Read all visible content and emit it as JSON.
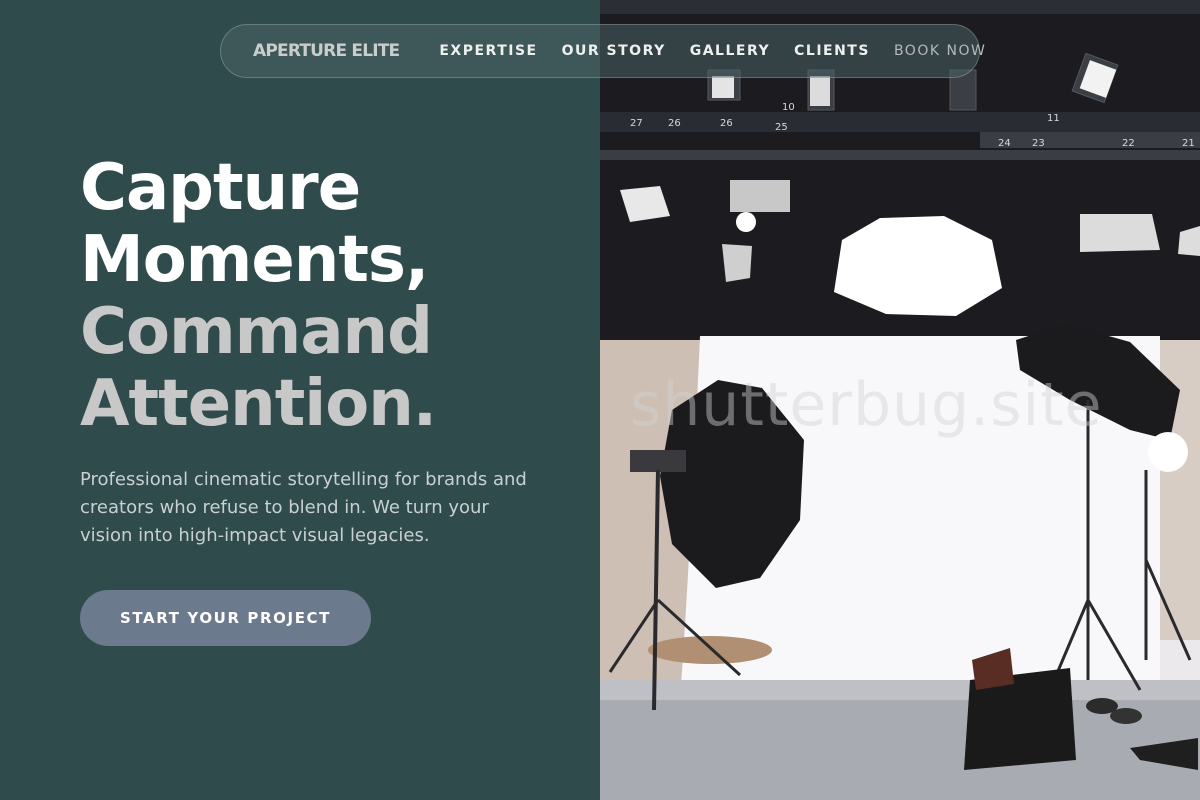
{
  "nav": {
    "brand": "APERTURE ELITE",
    "links": [
      {
        "label": "EXPERTISE"
      },
      {
        "label": "OUR STORY"
      },
      {
        "label": "GALLERY"
      },
      {
        "label": "CLIENTS"
      },
      {
        "label": "BOOK NOW"
      }
    ]
  },
  "hero": {
    "title_lines": [
      "Capture",
      "Moments,",
      "Command",
      "Attention."
    ],
    "subtitle": "Professional cinematic storytelling for brands and creators who refuse to blend in. We turn your vision into high-impact visual legacies.",
    "cta_label": "START YOUR PROJECT"
  },
  "image": {
    "watermark": "shutterbug.site",
    "rig_labels": [
      "27",
      "26",
      "26",
      "25",
      "10",
      "11",
      "24",
      "23",
      "22",
      "21"
    ]
  },
  "colors": {
    "left_bg": "#2f4b4c",
    "cta_bg": "#6b7a8c",
    "title_grey": "#c8c8c8"
  }
}
